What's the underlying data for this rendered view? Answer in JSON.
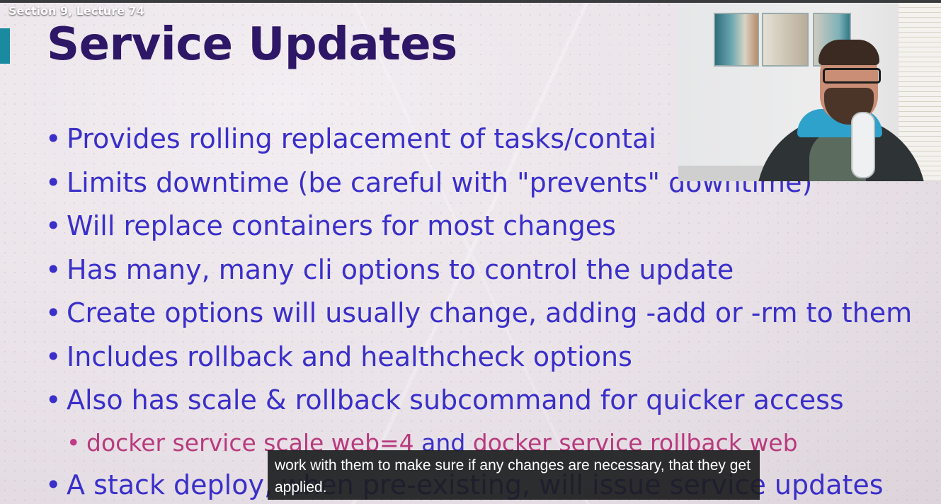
{
  "video": {
    "section_label": "Section 9, Lecture 74",
    "caption": "work with them to make sure if any changes are necessary, that they get applied."
  },
  "slide": {
    "title": "Service Updates",
    "bullets": [
      "Provides rolling replacement of tasks/contai",
      "Limits downtime (be careful with \"prevents\" downtime)",
      "Will replace containers for most changes",
      "Has many, many cli options to control the update",
      "Create options will usually change, adding -add or -rm to them",
      "Includes rollback and healthcheck options",
      "Also has scale & rollback subcommand for quicker access"
    ],
    "sub_bullet": {
      "part1": "docker service scale web=4",
      "part2": " and ",
      "part3": "docker service rollback web"
    },
    "last_bullet": "A stack deploy, when pre-existing, will issue service updates"
  },
  "colors": {
    "title": "#2e1766",
    "bullet_text": "#3a2fc9",
    "code_text": "#b83a7e",
    "accent": "#1a8aa0"
  }
}
